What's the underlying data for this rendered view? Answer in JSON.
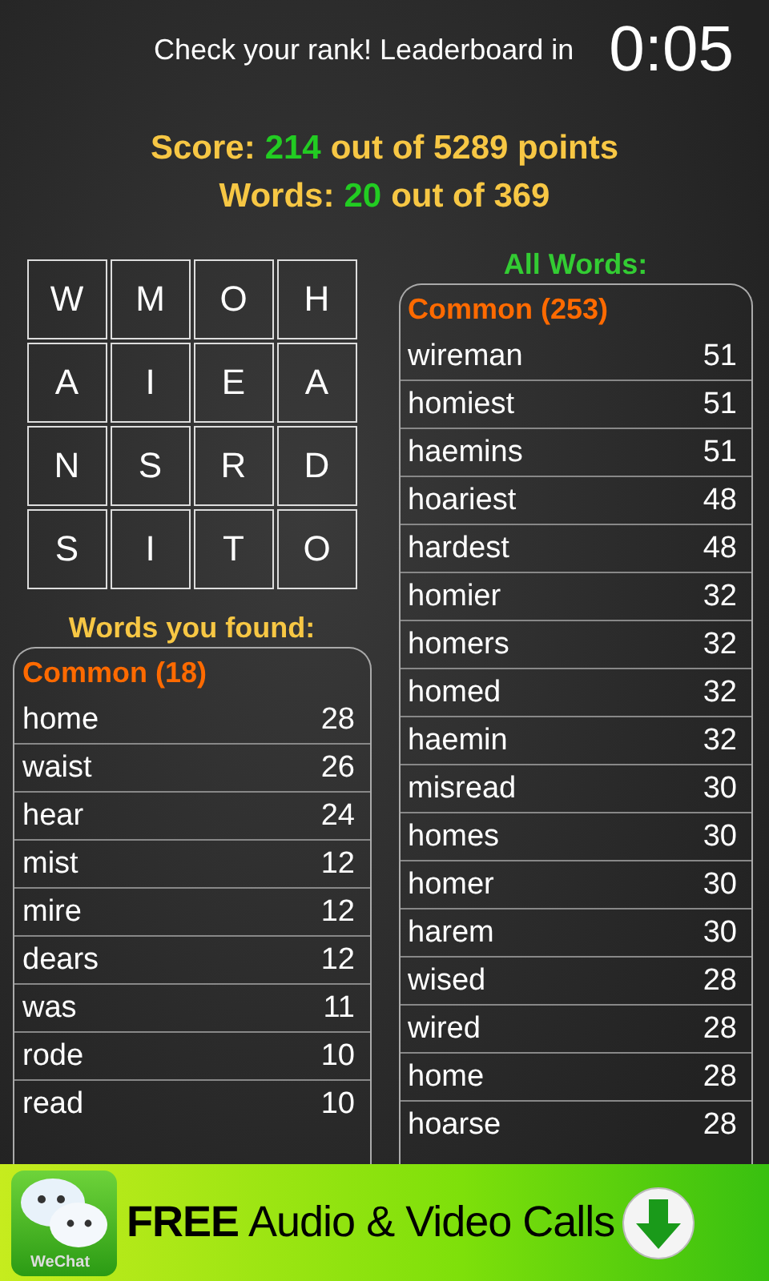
{
  "header": {
    "message": "Check your rank! Leaderboard in",
    "timer": "0:05"
  },
  "score": {
    "label": "Score:",
    "value": "214",
    "rest": "out of 5289 points"
  },
  "words": {
    "label": "Words:",
    "value": "20",
    "rest": "out of 369"
  },
  "board": [
    [
      "W",
      "M",
      "O",
      "H"
    ],
    [
      "A",
      "I",
      "E",
      "A"
    ],
    [
      "N",
      "S",
      "R",
      "D"
    ],
    [
      "S",
      "I",
      "T",
      "O"
    ]
  ],
  "found": {
    "title": "Words you found:",
    "section": "Common (18)",
    "rows": [
      {
        "word": "home",
        "points": "28"
      },
      {
        "word": "waist",
        "points": "26"
      },
      {
        "word": "hear",
        "points": "24"
      },
      {
        "word": "mist",
        "points": "12"
      },
      {
        "word": "mire",
        "points": "12"
      },
      {
        "word": "dears",
        "points": "12"
      },
      {
        "word": "was",
        "points": "11"
      },
      {
        "word": "rode",
        "points": "10"
      },
      {
        "word": "read",
        "points": "10"
      }
    ]
  },
  "all": {
    "title": "All Words:",
    "section": "Common (253)",
    "rows": [
      {
        "word": "wireman",
        "points": "51"
      },
      {
        "word": "homiest",
        "points": "51"
      },
      {
        "word": "haemins",
        "points": "51"
      },
      {
        "word": "hoariest",
        "points": "48"
      },
      {
        "word": "hardest",
        "points": "48"
      },
      {
        "word": "homier",
        "points": "32"
      },
      {
        "word": "homers",
        "points": "32"
      },
      {
        "word": "homed",
        "points": "32"
      },
      {
        "word": "haemin",
        "points": "32"
      },
      {
        "word": "misread",
        "points": "30"
      },
      {
        "word": "homes",
        "points": "30"
      },
      {
        "word": "homer",
        "points": "30"
      },
      {
        "word": "harem",
        "points": "30"
      },
      {
        "word": "wised",
        "points": "28"
      },
      {
        "word": "wired",
        "points": "28"
      },
      {
        "word": "home",
        "points": "28"
      },
      {
        "word": "hoarse",
        "points": "28"
      }
    ]
  },
  "ad": {
    "brand": "WeChat",
    "text_bold": "FREE",
    "text": "Audio & Video Calls"
  }
}
